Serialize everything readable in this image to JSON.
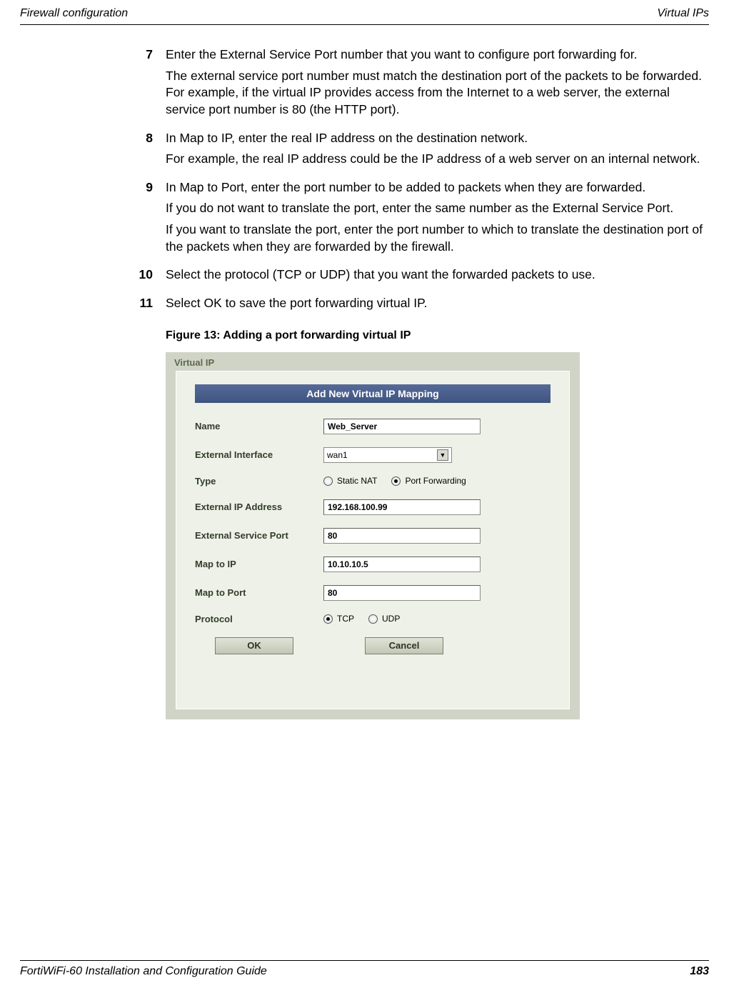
{
  "header": {
    "left": "Firewall configuration",
    "right": "Virtual IPs"
  },
  "steps": [
    {
      "num": "7",
      "paras": [
        "Enter the External Service Port number that you want to configure port forwarding for.",
        "The external service port number must match the destination port of the packets to be forwarded. For example, if the virtual IP provides access from the Internet to a web server, the external service port number is 80 (the HTTP port)."
      ]
    },
    {
      "num": "8",
      "paras": [
        "In Map to IP, enter the real IP address on the destination network.",
        "For example, the real IP address could be the IP address of a web server on an internal network."
      ]
    },
    {
      "num": "9",
      "paras": [
        "In Map to Port, enter the port number to be added to packets when they are forwarded.",
        "If you do not want to translate the port, enter the same number as the External Service Port.",
        "If you want to translate the port, enter the port number to which to translate the destination port of the packets when they are forwarded by the firewall."
      ]
    },
    {
      "num": "10",
      "paras": [
        "Select the protocol (TCP or UDP) that you want the forwarded packets to use."
      ]
    },
    {
      "num": "11",
      "paras": [
        "Select OK to save the port forwarding virtual IP."
      ]
    }
  ],
  "figure": {
    "caption": "Figure 13: Adding a port forwarding virtual IP",
    "tab": "Virtual IP",
    "panel_title": "Add New Virtual IP Mapping",
    "fields": {
      "name_label": "Name",
      "name_value": "Web_Server",
      "extif_label": "External Interface",
      "extif_value": "wan1",
      "type_label": "Type",
      "type_opt1": "Static NAT",
      "type_opt2": "Port Forwarding",
      "extip_label": "External IP Address",
      "extip_value": "192.168.100.99",
      "extport_label": "External Service Port",
      "extport_value": "80",
      "mapip_label": "Map to IP",
      "mapip_value": "10.10.10.5",
      "mapport_label": "Map to Port",
      "mapport_value": "80",
      "proto_label": "Protocol",
      "proto_opt1": "TCP",
      "proto_opt2": "UDP",
      "ok": "OK",
      "cancel": "Cancel"
    }
  },
  "footer": {
    "left": "FortiWiFi-60 Installation and Configuration Guide",
    "page": "183"
  }
}
